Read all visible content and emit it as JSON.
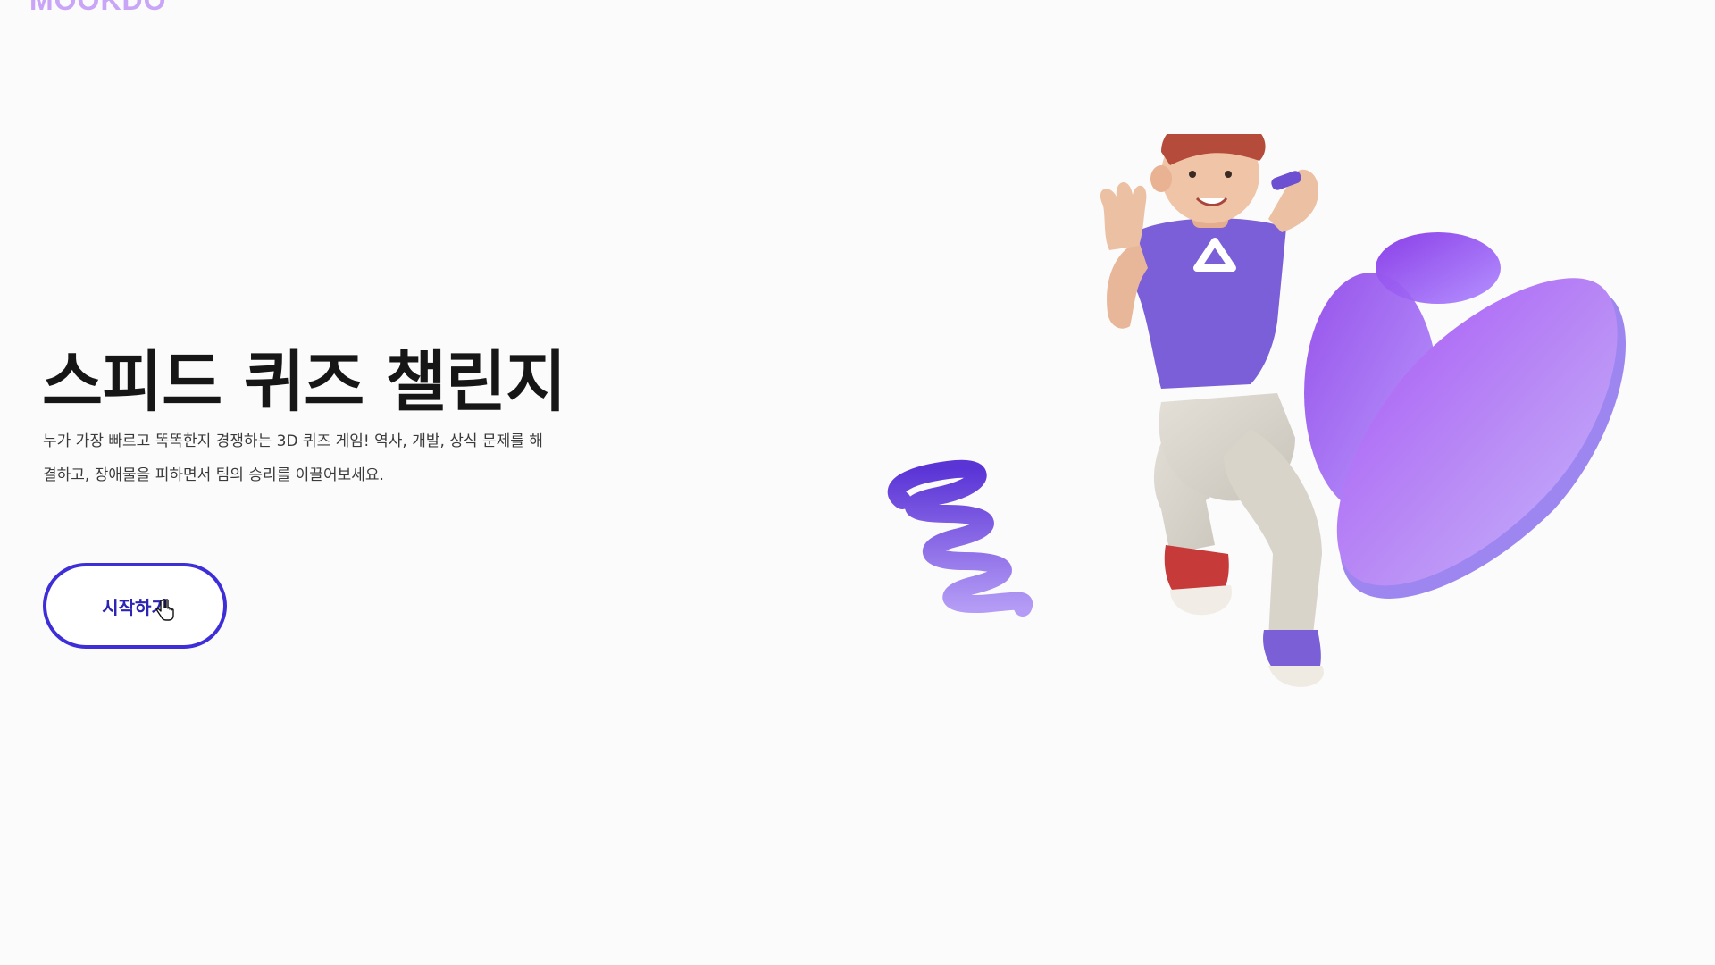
{
  "brand": {
    "logo_text": "MOOKDO"
  },
  "hero": {
    "title": "스피드 퀴즈 챌린지",
    "description": "누가 가장 빠르고 똑똑한지 경쟁하는 3D 퀴즈 게임! 역사, 개발, 상식 문제를 해결하고, 장애물을 피하면서 팀의 승리를 이끌어보세요.",
    "start_button_label": "시작하기"
  },
  "colors": {
    "accent": "#3d2ed8",
    "title": "#161616",
    "logo": "#c9a5f7",
    "illustration_purple": "#8b5cf6"
  },
  "icons": {
    "cursor": "hand-pointer-icon",
    "illustration": "3d-character-illustration"
  }
}
